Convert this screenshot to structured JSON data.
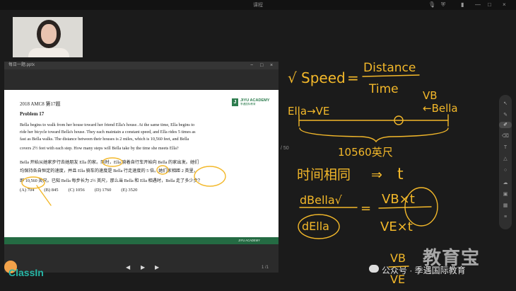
{
  "window": {
    "title": "课程",
    "controls": [
      "—",
      "□",
      "×"
    ]
  },
  "document": {
    "filename": "每日一题.pptx",
    "page_indicator": "/ 50",
    "slide_counter": "1 /1"
  },
  "slide": {
    "contest": "2018 AMC8 第17题",
    "logo": {
      "name": "JIYU ACADEMY",
      "sub": "季遇国际教育"
    },
    "problem": "Problem 17",
    "p1": "Bella begins to walk from her house toward her friend Ella's house. At the same time, Ella begins to",
    "p2": "ride her bicycle toward Bella's house. They each maintain a constant speed, and Ella rides 5 times as",
    "p3": "fast as Bella walks. The distance between their houses is 2 miles, which is 10,560 feet, and Bella",
    "p4": "covers 2½ feet with each step. How many steps will Bella take by the time she meets Ella?",
    "zh1": "Bella 开始从她家步行去她朋友 Ella 的家。同时，Ella 骑着自行车开始向 Bella 的家出发。她们",
    "zh2": "均保持各自恒定的速度，并且 Ella 骑车的速度是 Bella 行走速度的 5 倍。她们家相距 2 英里，",
    "zh3": "即 10,560 英尺。已知 Bella 每步长为 2½ 英尺，那么当 Bella 和 Ella 相遇时，Bella 走了多少步？",
    "options": [
      "(A) 704",
      "(B) 845",
      "(C) 1056",
      "(D) 1760",
      "(E) 3520"
    ],
    "footer": "JIYU ACADEMY"
  },
  "app": {
    "brand": "ClassIn"
  },
  "watermark": {
    "logo": "教育宝",
    "account": "公众号 · 季遇国际教育"
  },
  "annotations": {
    "check1": "√",
    "speed": "Speed",
    "eq": "=",
    "distance": "Distance",
    "time": "Time",
    "vb": "VB",
    "ella": "Ella→VE",
    "bella": "←Bella",
    "dist": "10560英尺",
    "time_same": "时间相同",
    "arrow": "⇒",
    "t": "t",
    "dbella": "dBella√",
    "della": "dElla",
    "frac_eq": "=",
    "vb_t": "VB×t",
    "ve_t": "VE×t",
    "vb2": "VB",
    "ve2": "VE",
    "color": "#f3b82a"
  },
  "toolbar": {
    "tools": [
      "pointer-icon",
      "pen-icon",
      "highlighter-icon",
      "eraser-icon",
      "text-icon",
      "shape-icon",
      "lasso-icon",
      "cloud-icon",
      "image-icon",
      "grid-icon",
      "layers-icon",
      "more-icon"
    ]
  }
}
